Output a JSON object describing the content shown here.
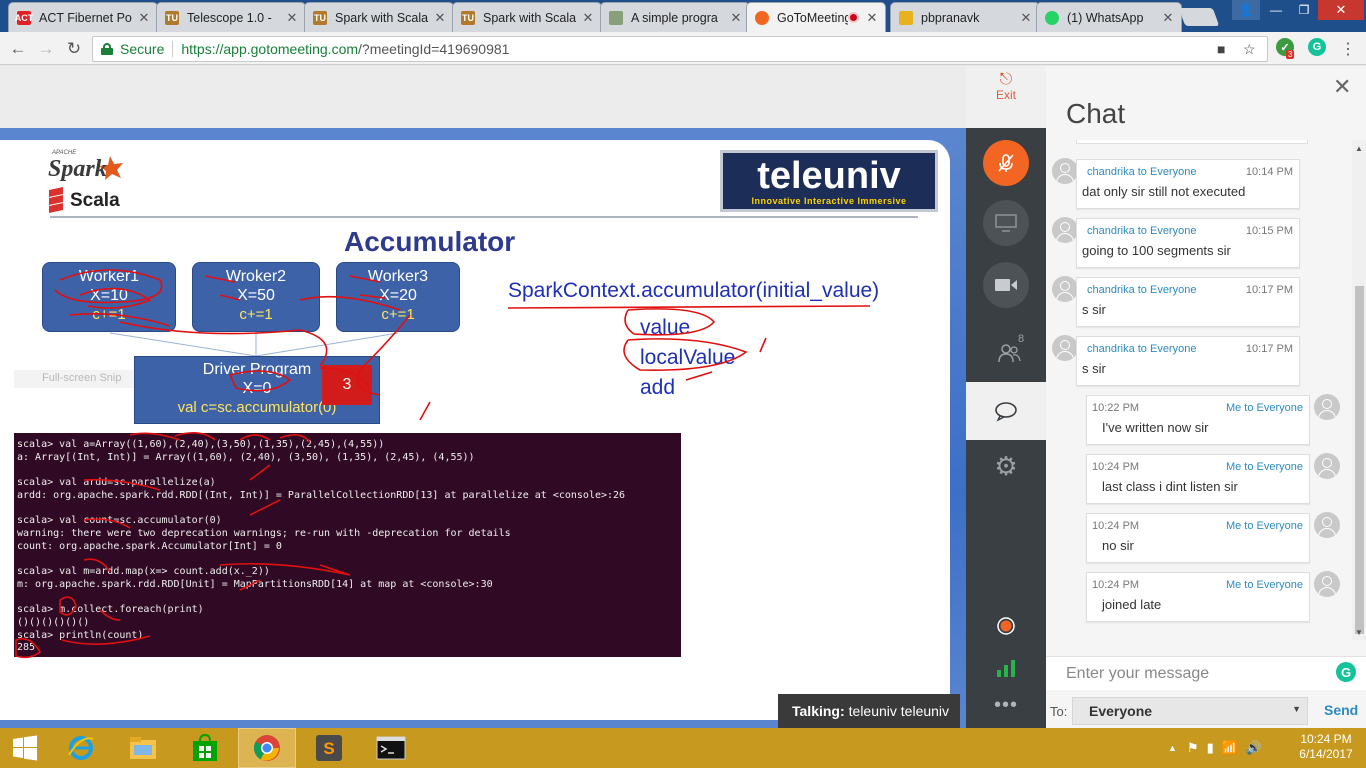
{
  "browser": {
    "tabs": [
      {
        "title": "ACT Fibernet Po",
        "favicon_text": "ACT",
        "favicon_color": "#e31e24"
      },
      {
        "title": "Telescope 1.0 -",
        "favicon_text": "TU",
        "favicon_color": "#b07a2a"
      },
      {
        "title": "Spark with Scala",
        "favicon_text": "TU",
        "favicon_color": "#b07a2a"
      },
      {
        "title": "Spark with Scala",
        "favicon_text": "TU",
        "favicon_color": "#b07a2a"
      },
      {
        "title": "A simple progra",
        "favicon_text": "",
        "favicon_color": "#8aa07a"
      },
      {
        "title": "GoToMeeting",
        "favicon_text": "",
        "favicon_color": "#f26522",
        "active": true,
        "recording": true
      },
      {
        "title": "pbpranavk",
        "favicon_text": "",
        "favicon_color": "#e8b21c"
      },
      {
        "title": "(1) WhatsApp",
        "favicon_text": "",
        "favicon_color": "#25d366"
      }
    ],
    "secure_label": "Secure",
    "url_host": "https://app.gotomeeting.com",
    "url_rest": "/?meetingId=419690981",
    "extension_badge": "3"
  },
  "slide": {
    "apache_label": "APACHE",
    "spark_label": "Spark",
    "scala_label": "Scala",
    "brand_name": "teleuniv",
    "brand_tagline": "Innovative Interactive Immersive",
    "title": "Accumulator",
    "workers": [
      {
        "name": "Worker1",
        "value": "X=10",
        "inc": "c+=1"
      },
      {
        "name": "Wroker2",
        "value": "X=50",
        "inc": "c+=1"
      },
      {
        "name": "Worker3",
        "value": "X=20",
        "inc": "c+=1"
      }
    ],
    "driver": {
      "title": "Driver Program",
      "value": "X=0",
      "code": "val c=sc.accumulator(0)",
      "badge": "3"
    },
    "api_signature": "SparkContext.accumulator(initial_value)",
    "api_items": [
      "value",
      "localValue",
      "add"
    ],
    "watermark": "Full-screen Snip",
    "terminal_lines": [
      "scala> val a=Array((1,60),(2,40),(3,50),(1,35),(2,45),(4,55))",
      "a: Array[(Int, Int)] = Array((1,60), (2,40), (3,50), (1,35), (2,45), (4,55))",
      "",
      "scala> val ardd=sc.parallelize(a)",
      "ardd: org.apache.spark.rdd.RDD[(Int, Int)] = ParallelCollectionRDD[13] at parallelize at <console>:26",
      "",
      "scala> val count=sc.accumulator(0)",
      "warning: there were two deprecation warnings; re-run with -deprecation for details",
      "count: org.apache.spark.Accumulator[Int] = 0",
      "",
      "scala> val m=ardd.map(x=> count.add(x._2))",
      "m: org.apache.spark.rdd.RDD[Unit] = MapPartitionsRDD[14] at map at <console>:30",
      "",
      "scala> m.collect.foreach(print)",
      "()()()()()()",
      "scala> println(count)",
      "285"
    ]
  },
  "talking": {
    "label": "Talking:",
    "name": "teleuniv teleuniv"
  },
  "sidebar": {
    "exit_label": "Exit",
    "attendee_count": "8"
  },
  "chat": {
    "title": "Chat",
    "messages": [
      {
        "from": "them",
        "sender": "chandrika to Everyone",
        "time": "10:14 PM",
        "text": "dat only sir still not executed"
      },
      {
        "from": "them",
        "sender": "chandrika to Everyone",
        "time": "10:15 PM",
        "text": "going to 100 segments sir"
      },
      {
        "from": "them",
        "sender": "chandrika to Everyone",
        "time": "10:17 PM",
        "text": "s sir"
      },
      {
        "from": "them",
        "sender": "chandrika to Everyone",
        "time": "10:17 PM",
        "text": "s sir"
      },
      {
        "from": "me",
        "sender": "Me to Everyone",
        "time": "10:22 PM",
        "text": "I've written now sir"
      },
      {
        "from": "me",
        "sender": "Me to Everyone",
        "time": "10:24 PM",
        "text": "last class i dint listen sir"
      },
      {
        "from": "me",
        "sender": "Me to Everyone",
        "time": "10:24 PM",
        "text": "no sir"
      },
      {
        "from": "me",
        "sender": "Me to Everyone",
        "time": "10:24 PM",
        "text": "joined late"
      }
    ],
    "input_placeholder": "Enter your message",
    "to_label": "To:",
    "to_value": "Everyone",
    "send_label": "Send"
  },
  "taskbar": {
    "time": "10:24 PM",
    "date": "6/14/2017"
  },
  "colors": {
    "accent": "#f26522",
    "link": "#2e8bc0",
    "slide_blue": "#3e62a8",
    "terminal": "#300a24",
    "taskbar": "#c79a1f"
  }
}
